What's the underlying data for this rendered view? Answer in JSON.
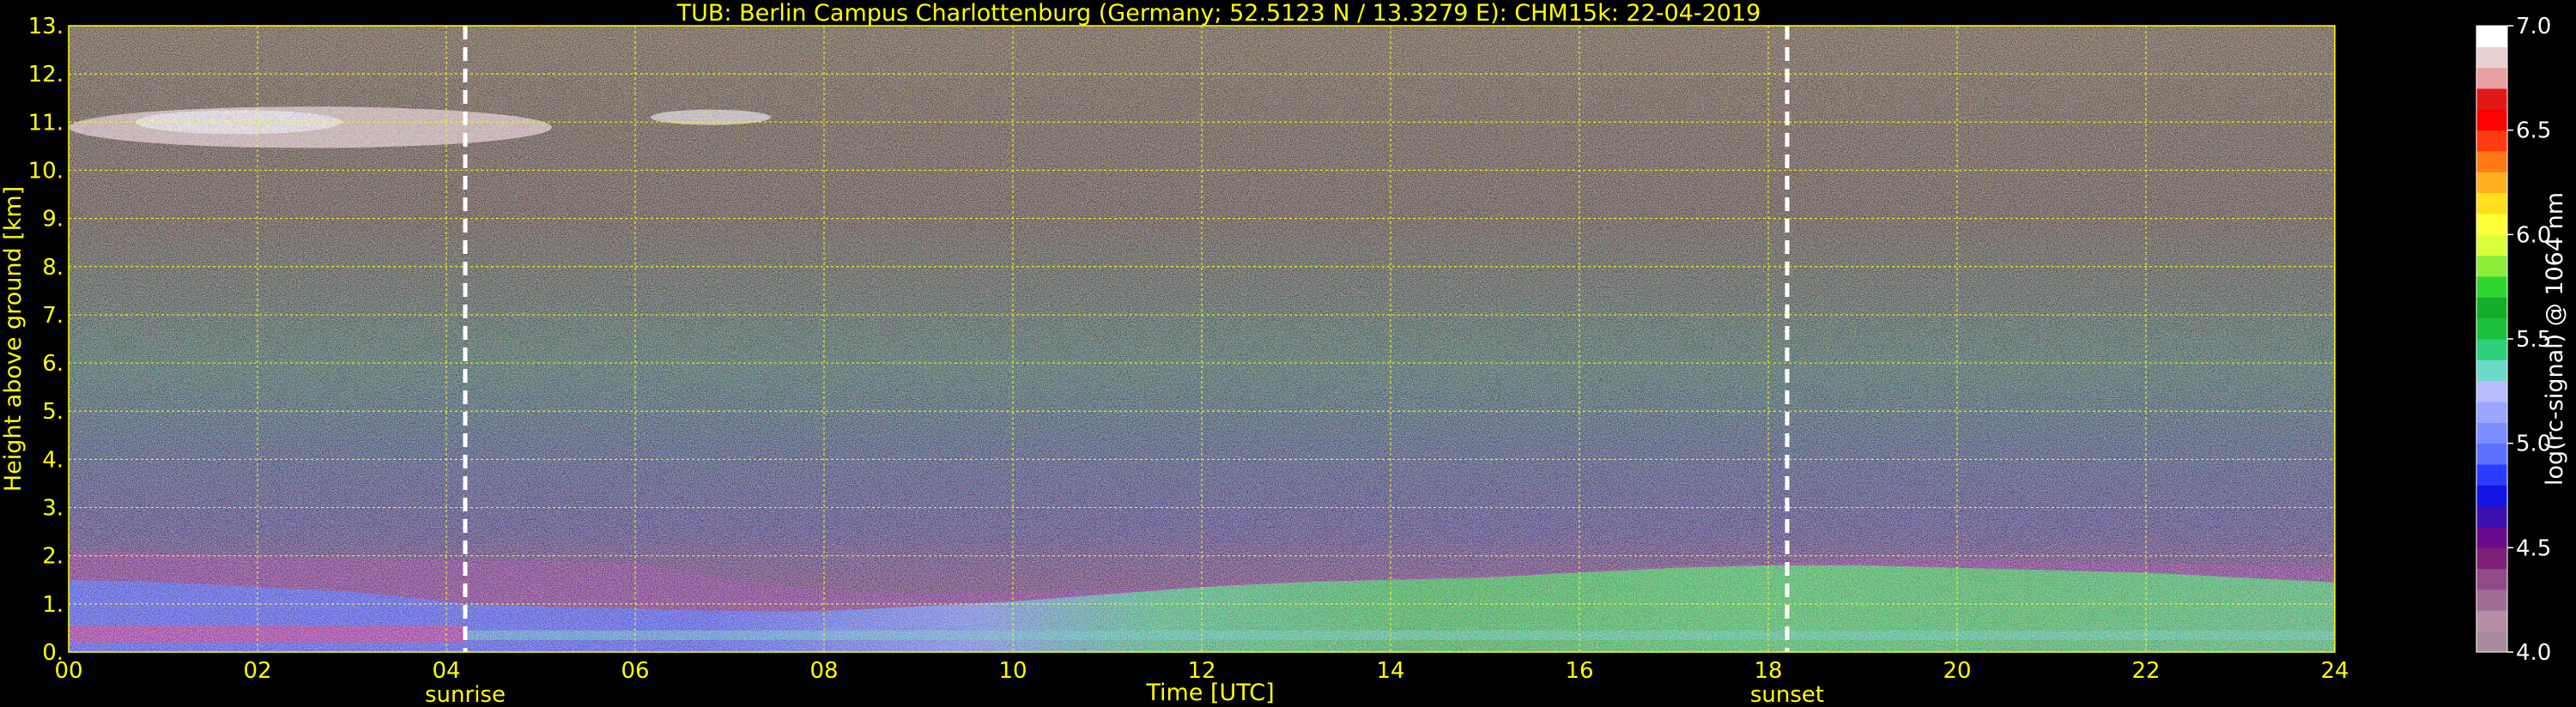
{
  "chart_data": {
    "type": "heatmap",
    "title": "TUB: Berlin Campus Charlottenburg (Germany; 52.5123 N / 13.3279 E):    CHM15k: 22-04-2019",
    "xlabel": "Time [UTC]",
    "ylabel": "Height above ground [km]",
    "xlim": [
      0,
      24
    ],
    "ylim": [
      0,
      13
    ],
    "x_ticks": [
      "00",
      "02",
      "04",
      "06",
      "08",
      "10",
      "12",
      "14",
      "16",
      "18",
      "20",
      "22",
      "24"
    ],
    "y_ticks": [
      "0.",
      "1.",
      "2.",
      "3.",
      "4.",
      "5.",
      "6.",
      "7.",
      "8.",
      "9.",
      "10.",
      "11.",
      "12.",
      "13."
    ],
    "grid": true,
    "events": [
      {
        "label": "sunrise",
        "x": 4.2
      },
      {
        "label": "sunset",
        "x": 18.2
      }
    ],
    "colorbar": {
      "label": "log(rc-signal) @ 1064 nm",
      "range": [
        4.0,
        7.0
      ],
      "ticks": [
        "4.0",
        "4.5",
        "5.0",
        "5.5",
        "6.0",
        "6.5",
        "7.0"
      ],
      "colors": [
        "#a8899f",
        "#b58ea6",
        "#a06d97",
        "#8f4a87",
        "#7d1f78",
        "#6a0a8c",
        "#3c0fb0",
        "#1414e6",
        "#2a3cff",
        "#5a70ff",
        "#7c8dff",
        "#9aa6ff",
        "#b8bcff",
        "#6bd9c8",
        "#2fd07c",
        "#1cc23b",
        "#14ad28",
        "#2fd62f",
        "#8cee3a",
        "#d8ff3a",
        "#ffff3a",
        "#ffdf1e",
        "#ffb01e",
        "#ff7a14",
        "#ff3c10",
        "#ff0000",
        "#e01818",
        "#e6a0a0",
        "#e8d0d0",
        "#ffffff"
      ]
    },
    "series": [
      {
        "x": [
          0,
          1,
          2,
          3,
          4,
          4.2,
          5,
          6,
          7,
          8,
          9,
          10,
          11,
          12,
          13,
          14,
          15,
          16,
          17,
          18,
          19,
          20,
          21,
          22,
          23,
          24
        ],
        "boundary_layer_top_km": [
          1.5,
          1.45,
          1.35,
          1.25,
          1.05,
          1.0,
          0.95,
          0.9,
          0.85,
          0.85,
          0.95,
          1.05,
          1.2,
          1.35,
          1.45,
          1.5,
          1.55,
          1.65,
          1.75,
          1.8,
          1.8,
          1.75,
          1.7,
          1.65,
          1.55,
          1.45
        ],
        "residual_layer_top_km": [
          2.1,
          2.05,
          2.0,
          1.95,
          1.9,
          1.9,
          1.9,
          1.85,
          1.5,
          1.3,
          1.2,
          1.25,
          1.3,
          1.4,
          1.5,
          1.55,
          1.6,
          1.7,
          1.8,
          1.85,
          1.95,
          1.95,
          1.9,
          1.85,
          1.8,
          1.75
        ]
      }
    ],
    "cirrus": {
      "x": [
        0,
        7.3
      ],
      "height_km": [
        10.5,
        11.5
      ]
    }
  }
}
